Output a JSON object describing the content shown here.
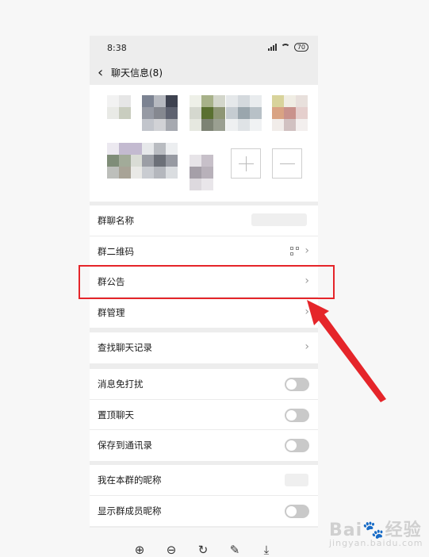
{
  "status": {
    "time": "8:38",
    "battery": "70"
  },
  "nav": {
    "back_icon": "chevron-left-icon",
    "title": "聊天信息(8)"
  },
  "settings": {
    "group_name_label": "群聊名称",
    "qr_label": "群二维码",
    "announcement_label": "群公告",
    "manage_label": "群管理",
    "search_history_label": "查找聊天记录",
    "mute_label": "消息免打扰",
    "mute_on": false,
    "pin_label": "置顶聊天",
    "pin_on": false,
    "save_contacts_label": "保存到通讯录",
    "save_contacts_on": false,
    "my_nickname_label": "我在本群的昵称",
    "show_nicknames_label": "显示群成员昵称",
    "show_nicknames_on": false
  },
  "toolbar": {
    "icons": [
      "zoom-in-icon",
      "zoom-out-icon",
      "rotate-icon",
      "edit-icon",
      "download-icon"
    ]
  },
  "watermark": {
    "text": "Bai",
    "text2": "经验",
    "sub": "jingyan.baidu.com"
  },
  "colors": {
    "highlight": "#e5252a",
    "arrow": "#e5252a"
  }
}
